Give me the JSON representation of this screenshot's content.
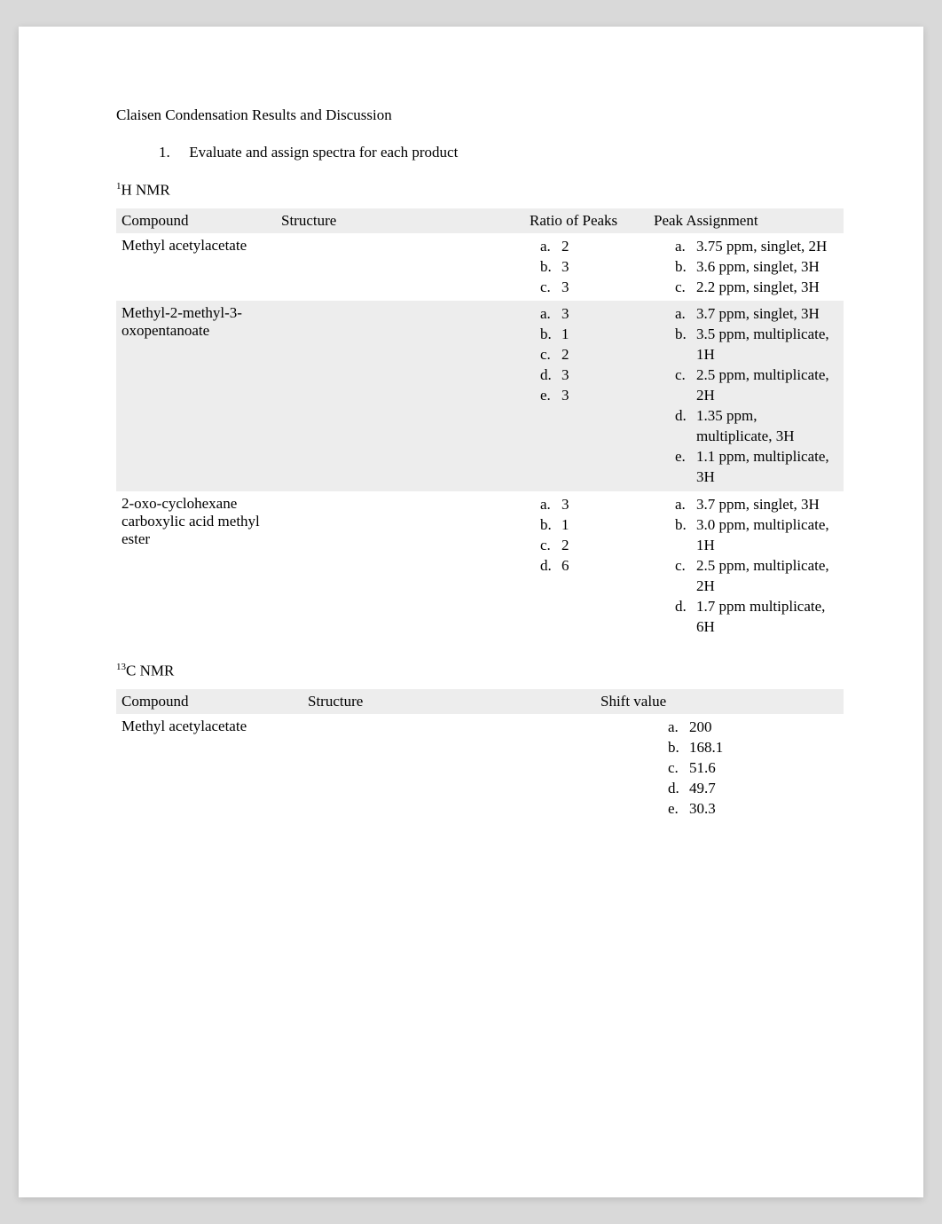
{
  "title": "Claisen Condensation Results and Discussion",
  "list1": {
    "num": "1.",
    "text": "Evaluate and assign spectra for each product"
  },
  "heading_hnmr_pre": "1",
  "heading_hnmr": "H NMR",
  "heading_cnmr_pre": "13",
  "heading_cnmr": "C NMR",
  "table1": {
    "headers": [
      "Compound",
      "Structure",
      "Ratio of Peaks",
      "Peak Assignment"
    ],
    "rows": [
      {
        "compound": "Methyl acetylacetate",
        "structure": "",
        "ratio": [
          {
            "l": "a.",
            "v": "2"
          },
          {
            "l": "b.",
            "v": "3"
          },
          {
            "l": "c.",
            "v": "3"
          }
        ],
        "peaks": [
          {
            "l": "a.",
            "v": "3.75 ppm, singlet, 2H"
          },
          {
            "l": "b.",
            "v": "3.6 ppm, singlet, 3H"
          },
          {
            "l": "c.",
            "v": "2.2 ppm, singlet, 3H"
          }
        ]
      },
      {
        "compound": "Methyl-2-methyl-3-oxopentanoate",
        "structure": "",
        "ratio": [
          {
            "l": "a.",
            "v": "3"
          },
          {
            "l": "b.",
            "v": "1"
          },
          {
            "l": "c.",
            "v": "2"
          },
          {
            "l": "d.",
            "v": "3"
          },
          {
            "l": "e.",
            "v": "3"
          }
        ],
        "peaks": [
          {
            "l": "a.",
            "v": "3.7 ppm, singlet, 3H"
          },
          {
            "l": "b.",
            "v": "3.5 ppm, multiplicate, 1H"
          },
          {
            "l": "c.",
            "v": "2.5 ppm, multiplicate, 2H"
          },
          {
            "l": "d.",
            "v": "1.35 ppm, multiplicate, 3H"
          },
          {
            "l": "e.",
            "v": "1.1 ppm, multiplicate, 3H"
          }
        ]
      },
      {
        "compound": "2-oxo-cyclohexane carboxylic acid methyl ester",
        "structure": "",
        "ratio": [
          {
            "l": "a.",
            "v": "3"
          },
          {
            "l": "b.",
            "v": "1"
          },
          {
            "l": "c.",
            "v": "2"
          },
          {
            "l": "d.",
            "v": "6"
          }
        ],
        "peaks": [
          {
            "l": "a.",
            "v": "3.7 ppm, singlet, 3H"
          },
          {
            "l": "b.",
            "v": "3.0 ppm, multiplicate, 1H"
          },
          {
            "l": "c.",
            "v": "2.5 ppm, multiplicate, 2H"
          },
          {
            "l": "d.",
            "v": "1.7 ppm multiplicate, 6H"
          }
        ]
      }
    ]
  },
  "table2": {
    "headers": [
      "Compound",
      "Structure",
      "Shift value"
    ],
    "rows": [
      {
        "compound": "Methyl acetylacetate",
        "structure": "",
        "shifts": [
          {
            "l": "a.",
            "v": "200"
          },
          {
            "l": "b.",
            "v": "168.1"
          },
          {
            "l": "c.",
            "v": "51.6"
          },
          {
            "l": "d.",
            "v": "49.7"
          },
          {
            "l": "e.",
            "v": "30.3"
          }
        ]
      }
    ]
  }
}
